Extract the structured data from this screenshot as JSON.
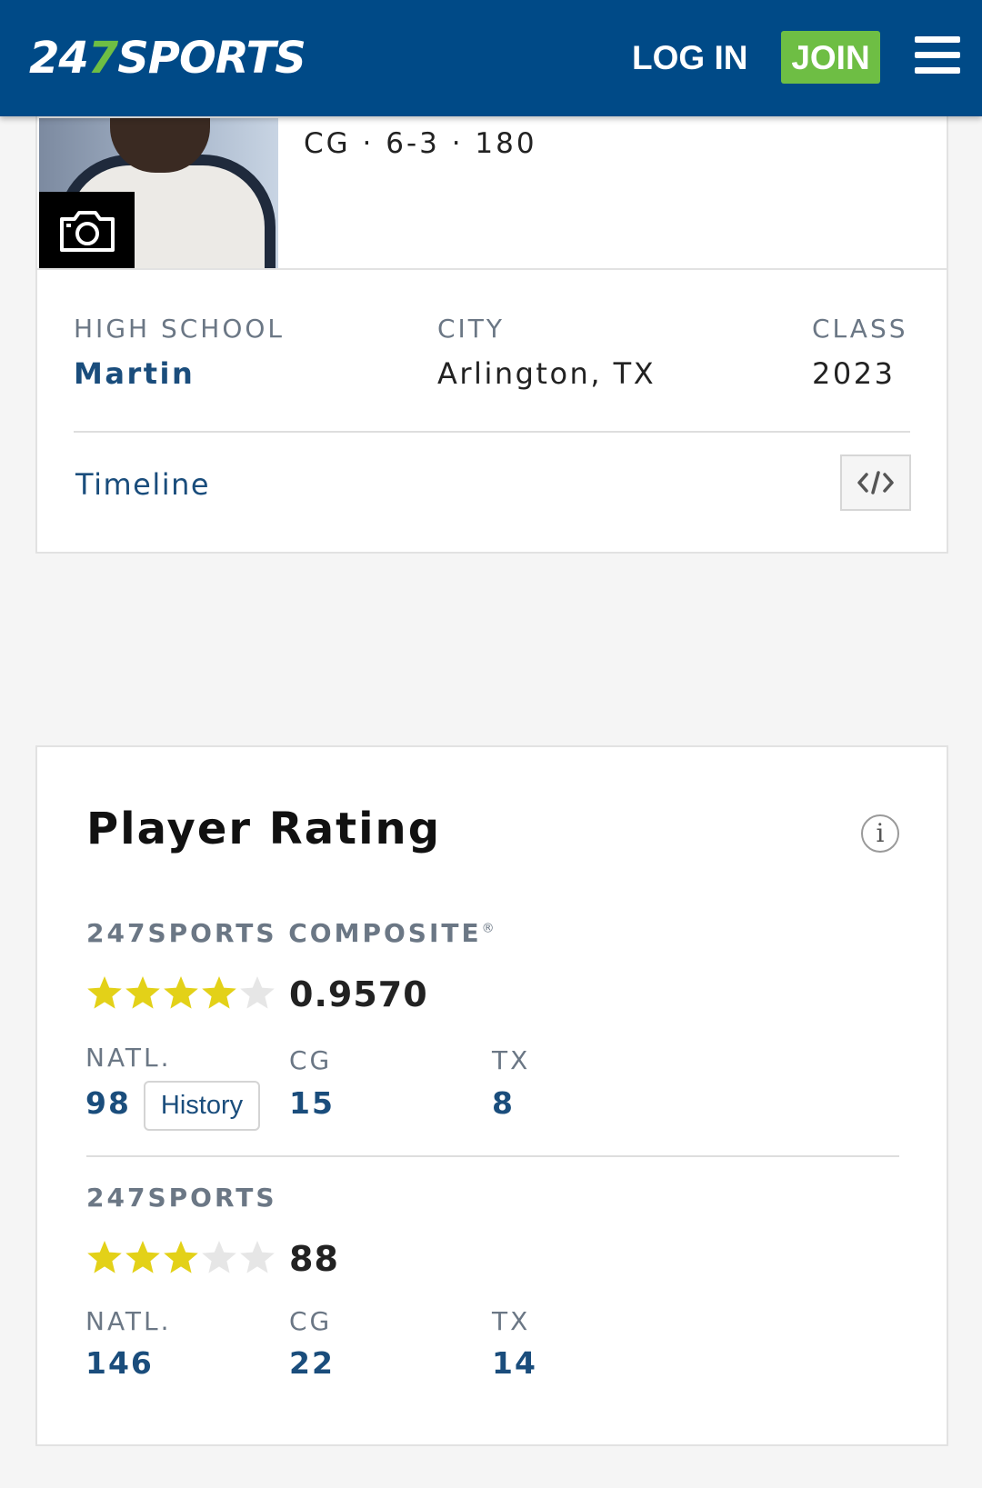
{
  "header": {
    "logo_prefix": "24",
    "logo_seven": "7",
    "logo_suffix": "SPORTS",
    "login_label": "LOG IN",
    "join_label": "JOIN",
    "menu_icon": "hamburger-icon",
    "brand_color": "#004a87",
    "accent_color": "#6ebe44"
  },
  "profile": {
    "vitals": "CG · 6-3 · 180",
    "photo_button_icon": "camera-icon",
    "high_school_label": "HIGH SCHOOL",
    "high_school_value": "Martin",
    "city_label": "CITY",
    "city_value": "Arlington, TX",
    "class_label": "CLASS",
    "class_value": "2023",
    "timeline_label": "Timeline",
    "embed_icon": "code-embed-icon"
  },
  "rating": {
    "title": "Player Rating",
    "info_icon": "info-icon",
    "composite": {
      "label": "247SPORTS COMPOSITE",
      "registered": "®",
      "stars": 4,
      "stars_max": 5,
      "score": "0.9570",
      "natl_label": "NATL.",
      "natl_value": "98",
      "history_label": "History",
      "pos_label": "CG",
      "pos_value": "15",
      "state_label": "TX",
      "state_value": "8"
    },
    "sports247": {
      "label": "247SPORTS",
      "stars": 3,
      "stars_max": 5,
      "score": "88",
      "natl_label": "NATL.",
      "natl_value": "146",
      "pos_label": "CG",
      "pos_value": "22",
      "state_label": "TX",
      "state_value": "14"
    },
    "star_color_on": "#e3d118",
    "star_color_off": "#e6e6e6"
  }
}
